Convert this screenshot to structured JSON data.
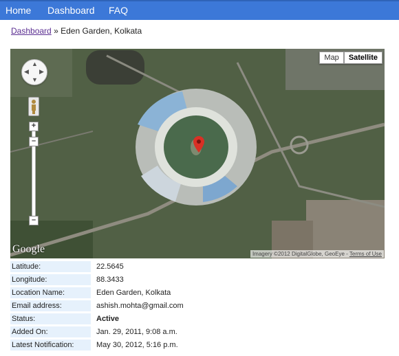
{
  "nav": {
    "home": "Home",
    "dashboard": "Dashboard",
    "faq": "FAQ"
  },
  "breadcrumb": {
    "link": "Dashboard",
    "separator": "»",
    "current": "Eden Garden, Kolkata"
  },
  "map": {
    "type_options": [
      "Map",
      "Satellite"
    ],
    "selected_type": "Satellite",
    "logo": "Google",
    "attribution": "Imagery ©2012 DigitalGlobe, GeoEye - ",
    "terms": "Terms of Use",
    "marker_color": "#d93025"
  },
  "details": [
    {
      "label": "Latitude:",
      "value": "22.5645"
    },
    {
      "label": "Longitude:",
      "value": "88.3433"
    },
    {
      "label": "Location Name:",
      "value": "Eden Garden, Kolkata"
    },
    {
      "label": "Email address:",
      "value": "ashish.mohta@gmail.com"
    },
    {
      "label": "Status:",
      "value": "Active"
    },
    {
      "label": "Added On:",
      "value": "Jan. 29, 2011, 9:08 a.m."
    },
    {
      "label": "Latest Notification:",
      "value": "May 30, 2012, 5:16 p.m."
    }
  ]
}
